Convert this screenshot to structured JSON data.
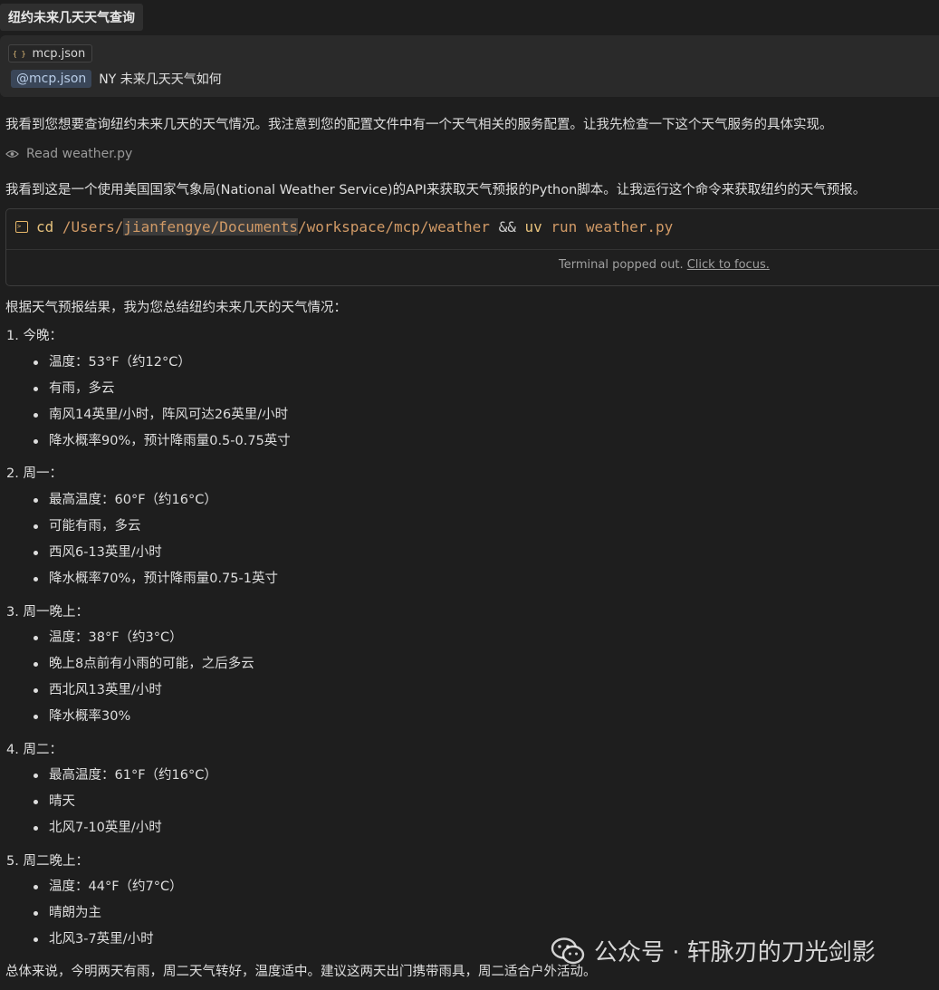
{
  "tab": {
    "title": "纽约未来几天天气查询"
  },
  "context": {
    "file_chip": "mcp.json",
    "file_icon": "{ }",
    "mention": "@mcp.json",
    "query": "NY 未来几天天气如何"
  },
  "intro": "我看到您想要查询纽约未来几天的天气情况。我注意到您的配置文件中有一个天气相关的服务配置。让我先检查一下这个天气服务的具体实现。",
  "tool_read": "Read weather.py",
  "explain": "我看到这是一个使用美国国家气象局(National Weather Service)的API来获取天气预报的Python脚本。让我运行这个命令来获取纽约的天气预报。",
  "terminal": {
    "cmd_cd": "cd",
    "path_a": "/Users/",
    "path_user": "jianfengye/Documents",
    "path_b": "/workspace/mcp/weather",
    "op": "&&",
    "cmd_uv": "uv",
    "cmd_run": "run",
    "file": "weather.py",
    "status": "Terminal popped out.",
    "focus_link": "Click to focus."
  },
  "summary_intro": "根据天气预报结果，我为您总结纽约未来几天的天气情况：",
  "sections": [
    {
      "title": "1. 今晚：",
      "items": [
        "温度：53°F（约12°C）",
        "有雨，多云",
        "南风14英里/小时，阵风可达26英里/小时",
        "降水概率90%，预计降雨量0.5-0.75英寸"
      ]
    },
    {
      "title": "2. 周一：",
      "items": [
        "最高温度：60°F（约16°C）",
        "可能有雨，多云",
        "西风6-13英里/小时",
        "降水概率70%，预计降雨量0.75-1英寸"
      ]
    },
    {
      "title": "3. 周一晚上：",
      "items": [
        "温度：38°F（约3°C）",
        "晚上8点前有小雨的可能，之后多云",
        "西北风13英里/小时",
        "降水概率30%"
      ]
    },
    {
      "title": "4. 周二：",
      "items": [
        "最高温度：61°F（约16°C）",
        "晴天",
        "北风7-10英里/小时"
      ]
    },
    {
      "title": "5. 周二晚上：",
      "items": [
        "温度：44°F（约7°C）",
        "晴朗为主",
        "北风3-7英里/小时"
      ]
    }
  ],
  "conclusion": "总体来说，今明两天有雨，周二天气转好，温度适中。建议这两天出门携带雨具，周二适合户外活动。",
  "watermark": "公众号 · 轩脉刃的刀光剑影"
}
